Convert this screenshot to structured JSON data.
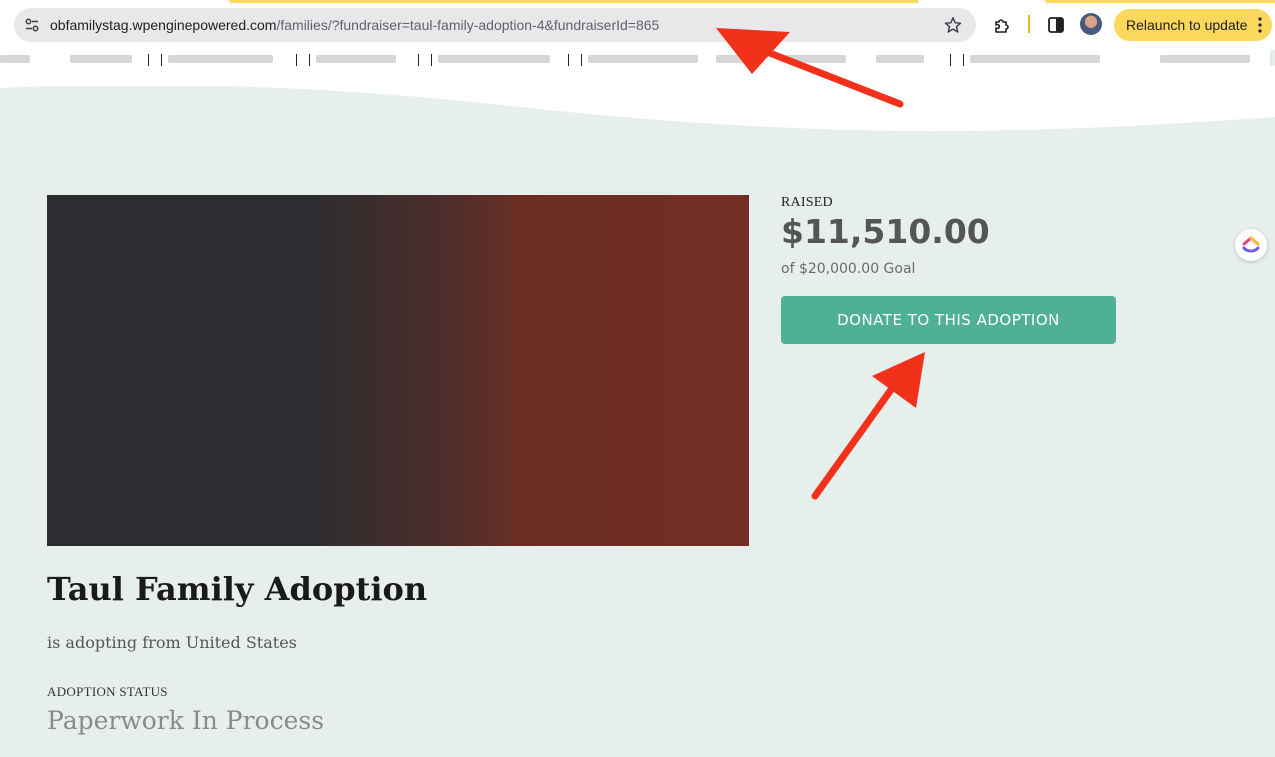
{
  "browser": {
    "url_host": "obfamilystag.wpenginepowered.com",
    "url_path": "/families/?fundraiser=taul-family-adoption-4&fundraiserId=865",
    "relaunch_label": "Relaunch to update"
  },
  "icons": {
    "site_info": "tune-icon",
    "bookmark_star": "star-icon",
    "extensions": "puzzle-icon",
    "side_panel": "side-panel-icon",
    "profile": "avatar",
    "menu": "kebab-icon",
    "page_widget": "clickup-icon"
  },
  "fundraiser": {
    "raised_label": "RAISED",
    "raised_amount": "$11,510.00",
    "goal_text": "of $20,000.00 Goal",
    "donate_label": "DONATE TO THIS ADOPTION",
    "title": "Taul Family Adoption",
    "subtitle": "is adopting from United States",
    "status_label": "ADOPTION STATUS",
    "status_value": "Paperwork In Process"
  },
  "colors": {
    "page_bg": "#e7efec",
    "donate_button": "#4fb096",
    "relaunch_chip": "#fbd75b",
    "annotation_arrow": "#f2311b"
  }
}
